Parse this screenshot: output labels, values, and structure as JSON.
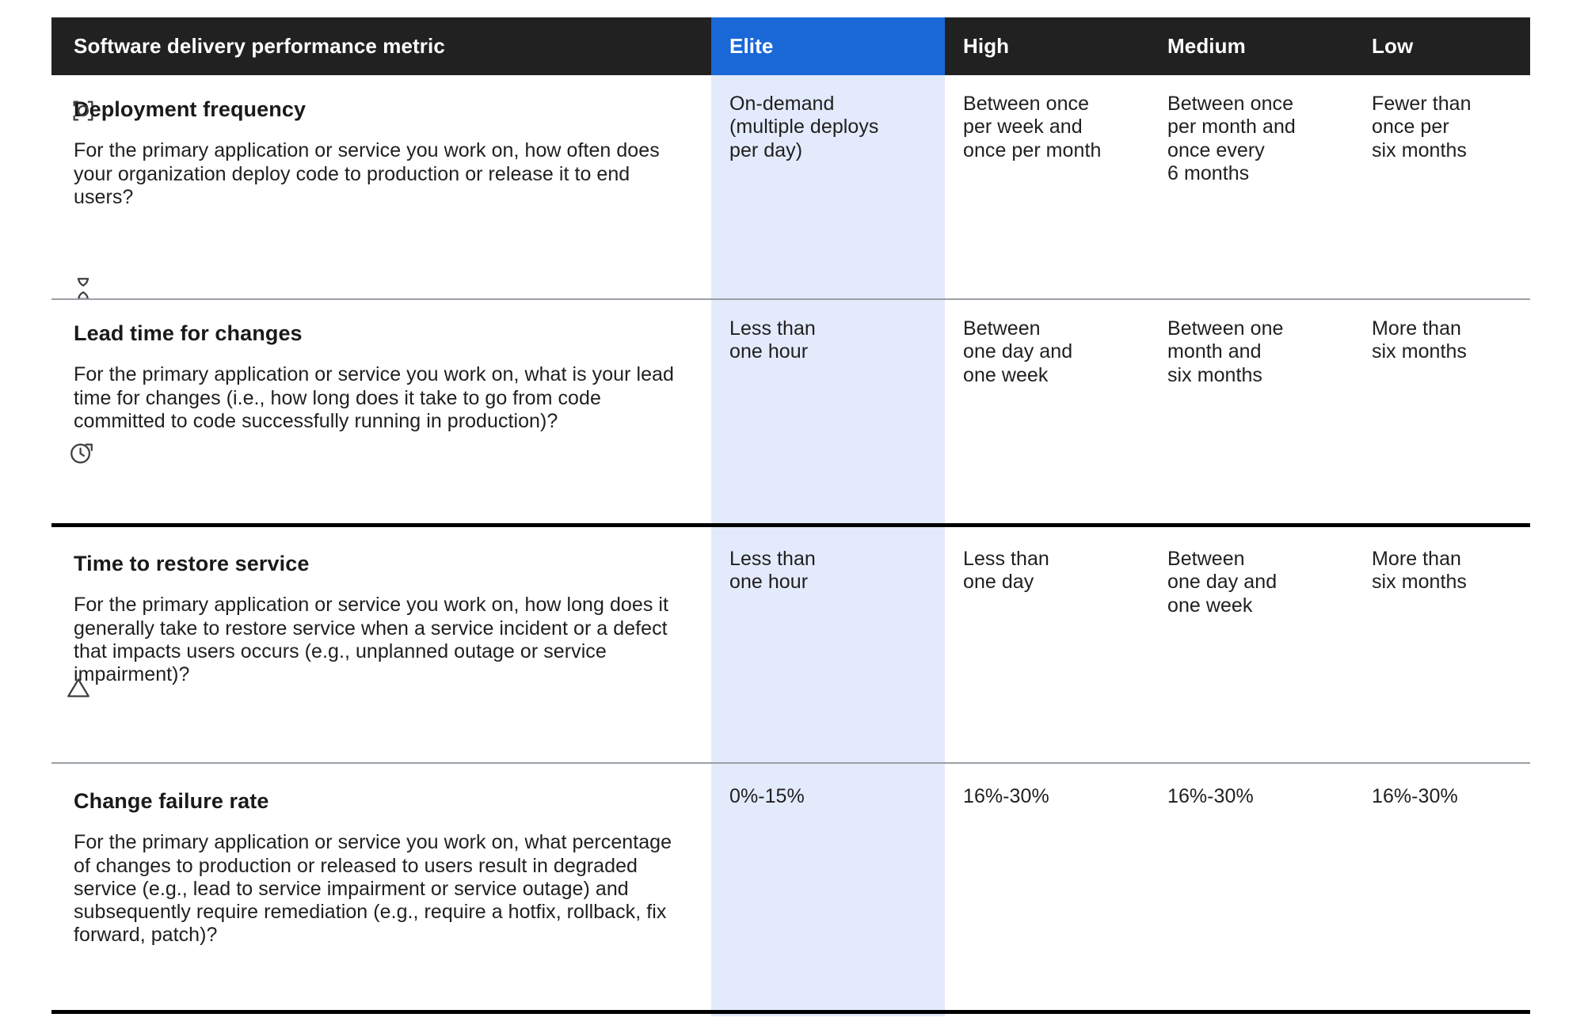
{
  "table": {
    "columns": [
      {
        "key": "metric",
        "label": "Software delivery performance metric"
      },
      {
        "key": "elite",
        "label": "Elite"
      },
      {
        "key": "high",
        "label": "High"
      },
      {
        "key": "medium",
        "label": "Medium"
      },
      {
        "key": "low",
        "label": "Low"
      }
    ],
    "highlight_column": "Elite",
    "colors": {
      "header_background": "#212121",
      "header_text": "#ffffff",
      "highlight_header": "#1a68d8",
      "highlight_column_background": "#e3eafc",
      "body_text": "#1f1f1f",
      "divider_thin": "#9aa0a6",
      "divider_thick": "#000000",
      "page_background": "#ffffff"
    },
    "rows": [
      {
        "icon": "deployment-rocket-icon",
        "title": "Deployment frequency",
        "description": "For the primary application or service you work on, how often does your organization deploy code to production or release it to end users?",
        "elite": "On-demand\n(multiple deploys\nper day)",
        "high": "Between once\nper week and\nonce per month",
        "medium": "Between once\nper month and\nonce every\n6 months",
        "low": "Fewer than\nonce per\nsix months"
      },
      {
        "icon": "hourglass-icon",
        "title": "Lead time for changes",
        "description": "For the primary application or service you work on, what is your lead time for changes (i.e., how long does it take to go from code committed to code successfully running in production)?",
        "elite": "Less than\none hour",
        "high": "Between\none day and\none week",
        "medium": "Between one\nmonth and\nsix months",
        "low": "More than\nsix months"
      },
      {
        "icon": "clock-restore-icon",
        "title": "Time to restore service",
        "description": "For the primary application or service you work on, how long does it generally take to restore service when a service incident or a defect that impacts users occurs (e.g., unplanned outage or service impairment)?",
        "elite": "Less than\none hour",
        "high": "Less than\none day",
        "medium": "Between\none day and\none week",
        "low": "More than\nsix months"
      },
      {
        "icon": "warning-triangle-icon",
        "title": "Change failure rate",
        "description": "For the primary application or service you work on, what percentage of changes to production or released to users result in degraded service (e.g., lead to service impairment or service outage) and subsequently require remediation (e.g., require a hotfix, rollback, fix forward, patch)?",
        "elite": "0%-15%",
        "high": "16%-30%",
        "medium": "16%-30%",
        "low": "16%-30%"
      }
    ]
  }
}
